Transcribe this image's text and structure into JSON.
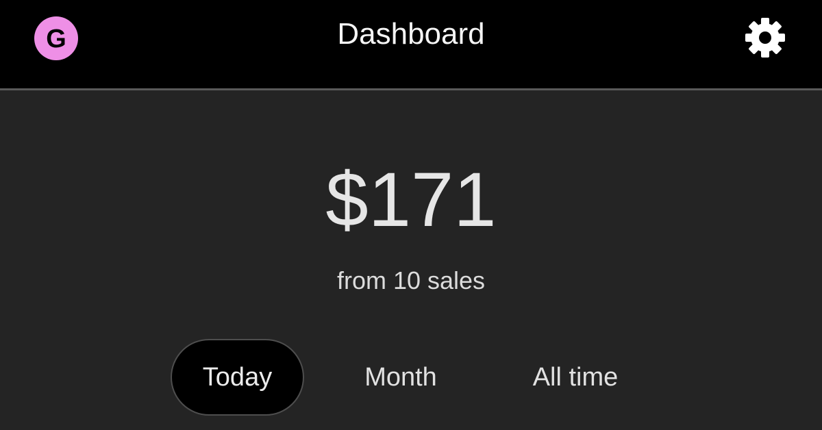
{
  "header": {
    "logo_letter": "G",
    "title": "Dashboard",
    "settings_icon": "gear-icon"
  },
  "summary": {
    "amount": "$171",
    "subtitle": "from 10 sales"
  },
  "tabs": [
    {
      "label": "Today",
      "active": true
    },
    {
      "label": "Month",
      "active": false
    },
    {
      "label": "All time",
      "active": false
    }
  ],
  "colors": {
    "brand_pink": "#ee8fe6",
    "header_bg": "#000000",
    "body_bg": "#242424",
    "text": "#e6e6e6"
  }
}
